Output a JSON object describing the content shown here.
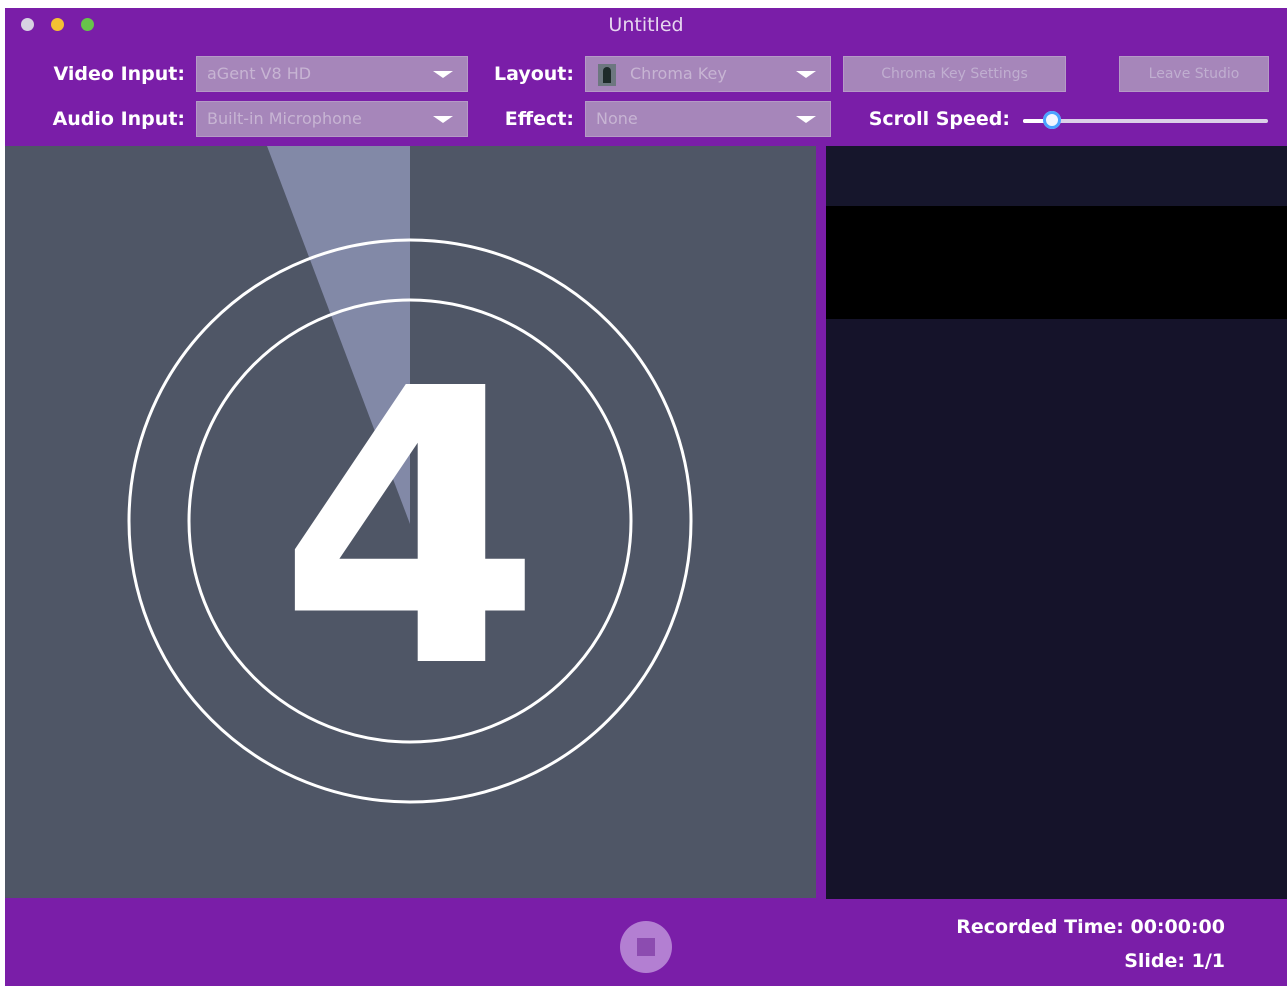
{
  "window": {
    "title": "Untitled"
  },
  "toolbar": {
    "video_input_label": "Video Input:",
    "video_input_value": "aGent V8 HD",
    "audio_input_label": "Audio Input:",
    "audio_input_value": "Built-in Microphone",
    "layout_label": "Layout:",
    "layout_value": "Chroma Key",
    "effect_label": "Effect:",
    "effect_value": "None",
    "chroma_settings_label": "Chroma Key Settings",
    "leave_studio_label": "Leave Studio",
    "scroll_speed_label": "Scroll Speed:",
    "scroll_speed_value": 0.12
  },
  "preview": {
    "countdown": "4"
  },
  "status": {
    "recorded_time": "Recorded Time: 00:00:00",
    "slide": "Slide: 1/1"
  },
  "icons": [
    "close-icon",
    "minimize-icon",
    "zoom-icon",
    "chevron-down-icon",
    "person-silhouette-icon",
    "stop-icon"
  ],
  "colors": {
    "accent": "#7a1ea8",
    "preview_bg": "#4f5666",
    "panel_bg": "#15132a"
  }
}
